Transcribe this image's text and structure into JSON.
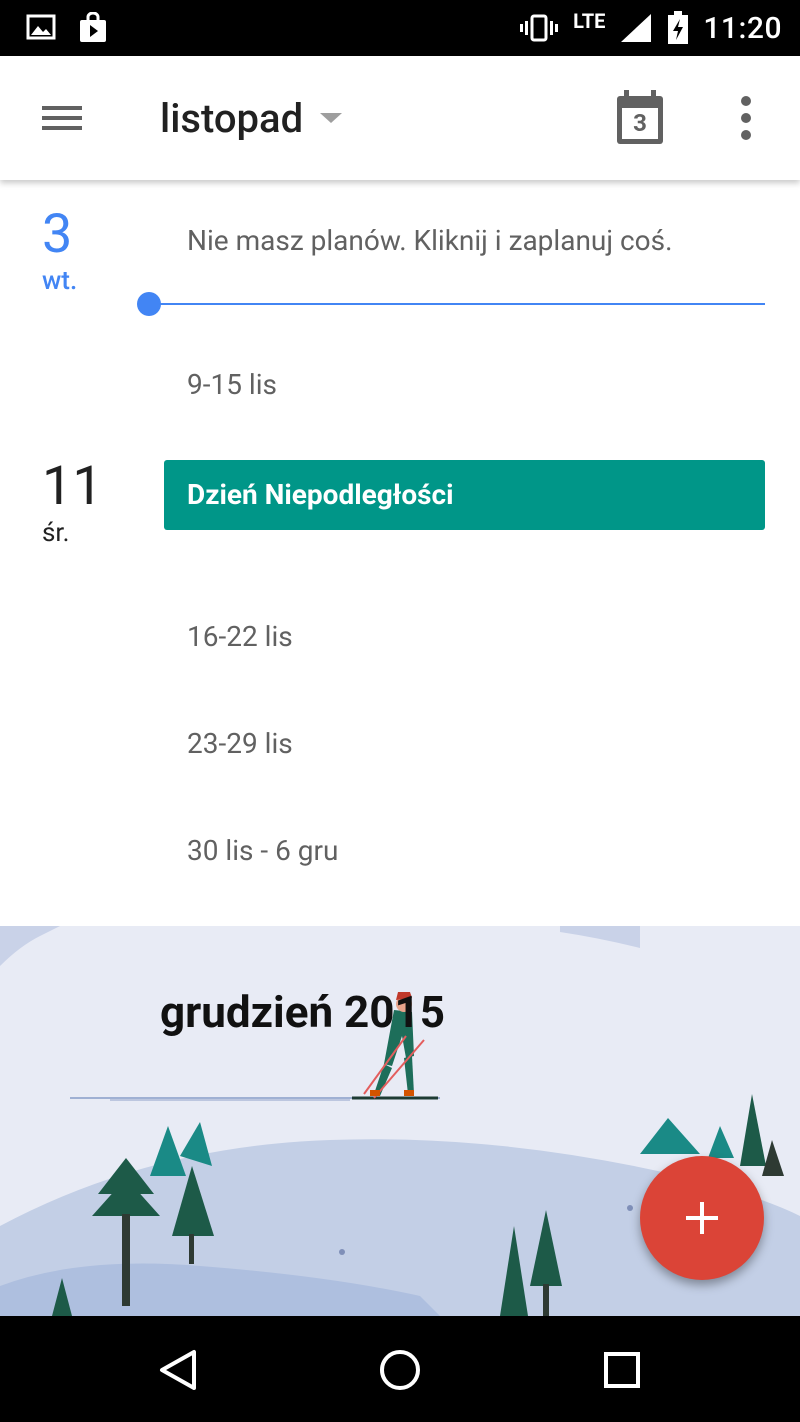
{
  "status_bar": {
    "time": "11:20",
    "network": "LTE",
    "icons": [
      "image-icon",
      "shopping-bag-icon",
      "vibrate-icon",
      "signal-icon",
      "battery-charging-icon"
    ]
  },
  "app_bar": {
    "title": "listopad",
    "today_date": "3",
    "icons": [
      "menu-icon",
      "dropdown-arrow-icon",
      "calendar-today-icon",
      "more-vert-icon"
    ]
  },
  "agenda": {
    "today": {
      "number": "3",
      "weekday": "wt.",
      "message": "Nie masz planów. Kliknij i zaplanuj coś."
    },
    "weeks": [
      {
        "label": "9-15 lis"
      },
      {
        "label": "16-22 lis"
      },
      {
        "label": "23-29 lis"
      },
      {
        "label": "30 lis - 6 gru"
      }
    ],
    "event_day": {
      "number": "11",
      "weekday": "śr.",
      "event_title": "Dzień Niepodległości"
    }
  },
  "month_banner": {
    "title": "grudzień 2015"
  },
  "fab": {
    "icon": "plus-icon"
  },
  "nav_bar": {
    "icons": [
      "back-icon",
      "home-icon",
      "recents-icon"
    ]
  },
  "colors": {
    "accent_blue": "#4285f4",
    "event_teal": "#009688",
    "fab_red": "#db4437"
  }
}
